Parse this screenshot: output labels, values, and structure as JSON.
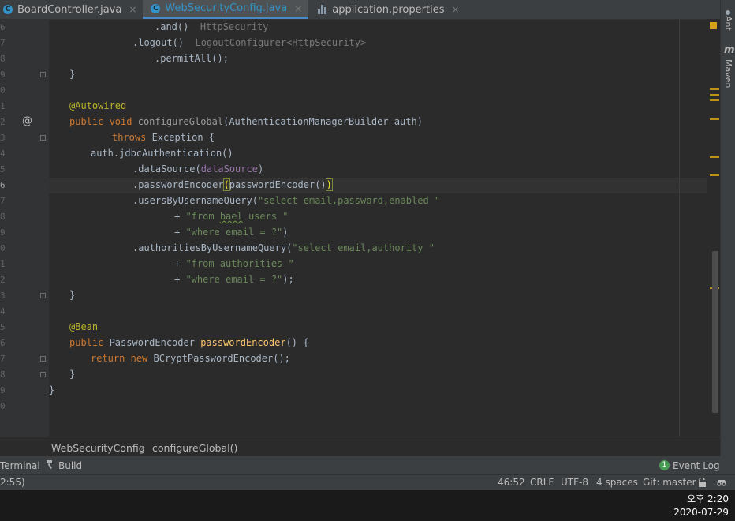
{
  "tabs": [
    {
      "label": "BoardController.java",
      "icon": "java-class-icon",
      "active": false
    },
    {
      "label": "WebSecurityConfig.java",
      "icon": "java-class-icon",
      "active": true
    },
    {
      "label": "application.properties",
      "icon": "properties-file-icon",
      "active": false
    }
  ],
  "tab_close": "×",
  "line_numbers": [
    "6",
    "7",
    "8",
    "9",
    "0",
    "1",
    "2",
    "3",
    "4",
    "5",
    "6",
    "7",
    "8",
    "9",
    "0",
    "1",
    "2",
    "3",
    "4",
    "5",
    "6",
    "7",
    "8",
    "9",
    "0"
  ],
  "code": {
    "l0_a": ".and()",
    "l0_hint": "HttpSecurity",
    "l1_a": ".logout()",
    "l1_hint": "LogoutConfigurer<HttpSecurity>",
    "l2_a": ".permitAll();",
    "l3_a": "}",
    "l5_ann": "@Autowired",
    "l6_kw": "public void",
    "l6_fn": "configureGlobal",
    "l6_rest": "(AuthenticationManagerBuilder auth)",
    "l7_kw": "throws",
    "l7_rest": " Exception {",
    "l8_a": "auth.jdbcAuthentication()",
    "l9_a": ".dataSource(",
    "l9_field": "dataSource",
    "l9_b": ")",
    "l10_a": ".passwordEncoder",
    "l10_open": "(",
    "l10_b": "passwordEncoder()",
    "l10_close": ")",
    "l11_a": ".usersByUsernameQuery(",
    "l11_str": "\"select email,password,enabled \"",
    "l12_a": "+ ",
    "l12_s1": "\"from ",
    "l12_s2": "bael",
    "l12_s3": " users \"",
    "l13_a": "+ ",
    "l13_str": "\"where email = ?\"",
    "l13_b": ")",
    "l14_a": ".authoritiesByUsernameQuery(",
    "l14_str": "\"select email,authority \"",
    "l15_a": "+ ",
    "l15_str": "\"from authorities \"",
    "l16_a": "+ ",
    "l16_str": "\"where email = ?\"",
    "l16_b": ");",
    "l17_a": "}",
    "l19_ann": "@Bean",
    "l20_kw": "public",
    "l20_mid": " PasswordEncoder ",
    "l20_fn": "passwordEncoder",
    "l20_rest": "() {",
    "l21_kw1": "return",
    "l21_kw2": "new",
    "l21_rest": " BCryptPasswordEncoder();",
    "l22_a": "}",
    "l23_a": "}"
  },
  "gutter_at": "@",
  "breadcrumb": {
    "class": "WebSecurityConfig",
    "sep": "›",
    "method": "configureGlobal()"
  },
  "tool_windows": {
    "terminal": "Terminal",
    "build": "Build",
    "event_log": "Event Log",
    "event_log_count": "1"
  },
  "right_panels": {
    "ant": "Ant",
    "maven_glyph": "m",
    "maven": "Maven"
  },
  "status": {
    "left": "2:55)",
    "position": "46:52",
    "line_sep": "CRLF",
    "encoding": "UTF-8",
    "indent": "4 spaces",
    "vcs": "Git: master"
  },
  "taskbar": {
    "time": "오후 2:20",
    "date": "2020-07-29"
  },
  "colors": {
    "keyword": "#cc7832",
    "annotation": "#bbb529",
    "string": "#6a8759",
    "method": "#ffc66d",
    "field": "#9876aa",
    "active_tab": "#3592c4"
  }
}
